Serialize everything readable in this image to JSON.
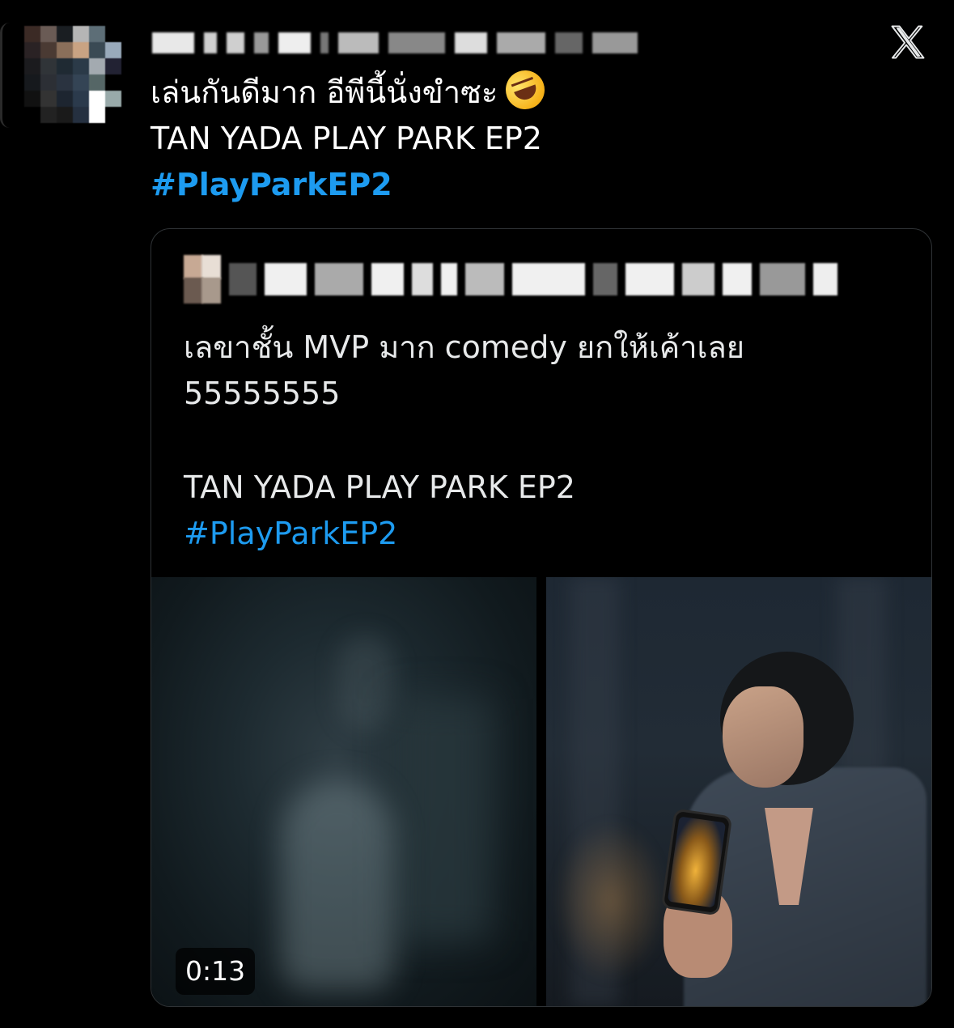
{
  "tweet": {
    "text_line1": "เล่นกันดีมาก อีพีนี้นั่งขำซะ",
    "text_line2": "TAN YADA PLAY PARK EP2",
    "hashtag": "#PlayParkEP2",
    "emoji_icon": "rolling-on-floor-laughing-emoji"
  },
  "quoted_tweet": {
    "line1": "เลขาชั้น MVP มาก comedy ยกให้เค้าเลย",
    "line2": "55555555",
    "line3": "TAN YADA PLAY PARK EP2",
    "hashtag": "#PlayParkEP2",
    "video_duration": "0:13"
  },
  "icons": {
    "platform_logo": "x-logo-icon"
  },
  "colors": {
    "background": "#000000",
    "hashtag_blue": "#1d9bf0",
    "text": "#e7e9ea",
    "card_border": "#2f3336"
  }
}
